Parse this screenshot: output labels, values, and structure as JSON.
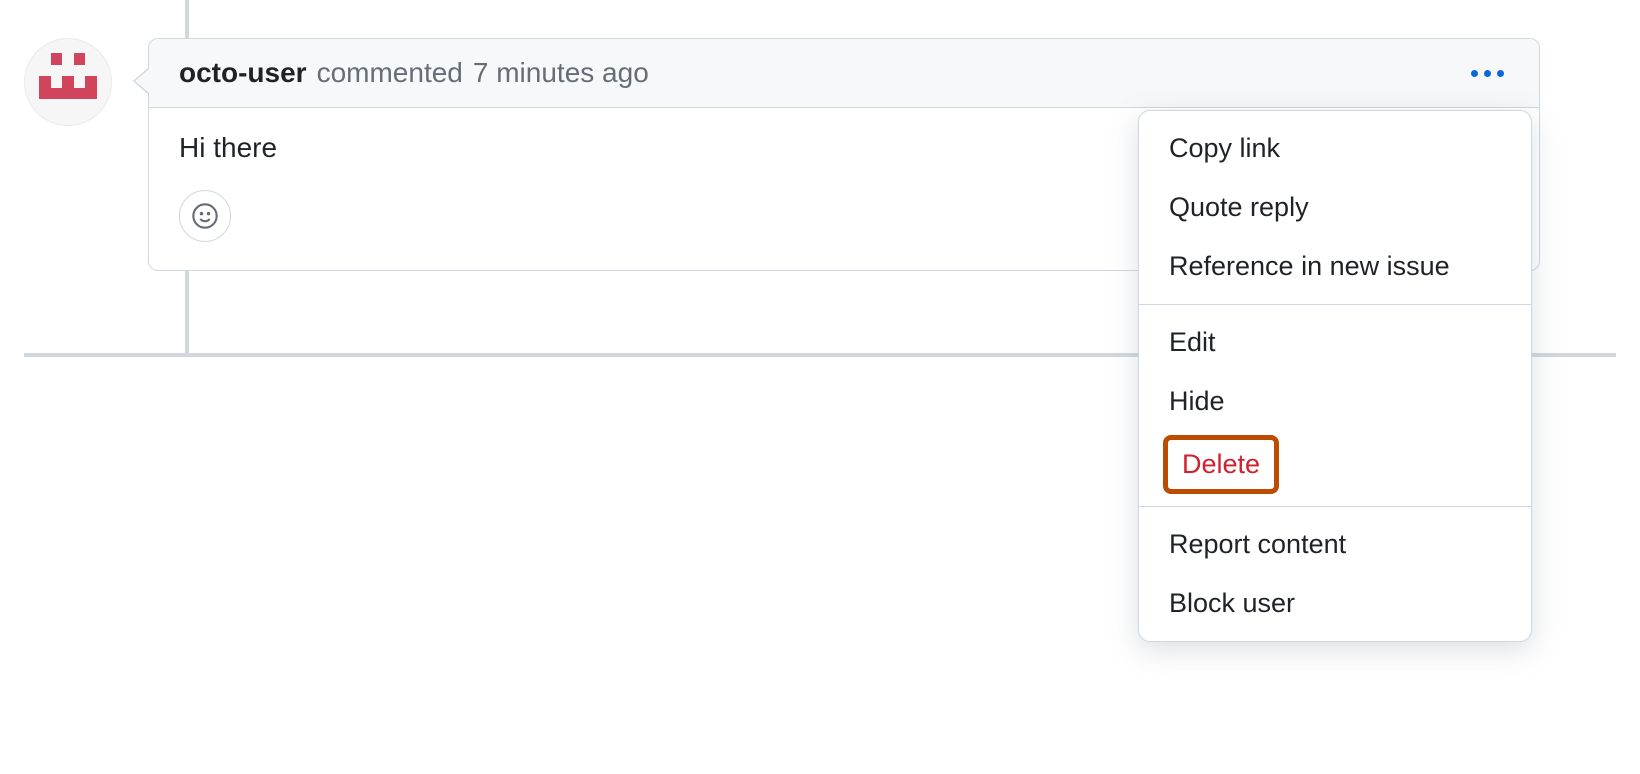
{
  "comment": {
    "username": "octo-user",
    "action": "commented",
    "timestamp": "7 minutes ago",
    "body": "Hi there"
  },
  "icons": {
    "kebab": "more-options",
    "reaction": "smiley"
  },
  "menu": {
    "copy_link": "Copy link",
    "quote_reply": "Quote reply",
    "reference_issue": "Reference in new issue",
    "edit": "Edit",
    "hide": "Hide",
    "delete": "Delete",
    "report": "Report content",
    "block": "Block user"
  },
  "colors": {
    "accent": "#0969da",
    "danger": "#cf222e",
    "highlight": "#bc4c00"
  }
}
